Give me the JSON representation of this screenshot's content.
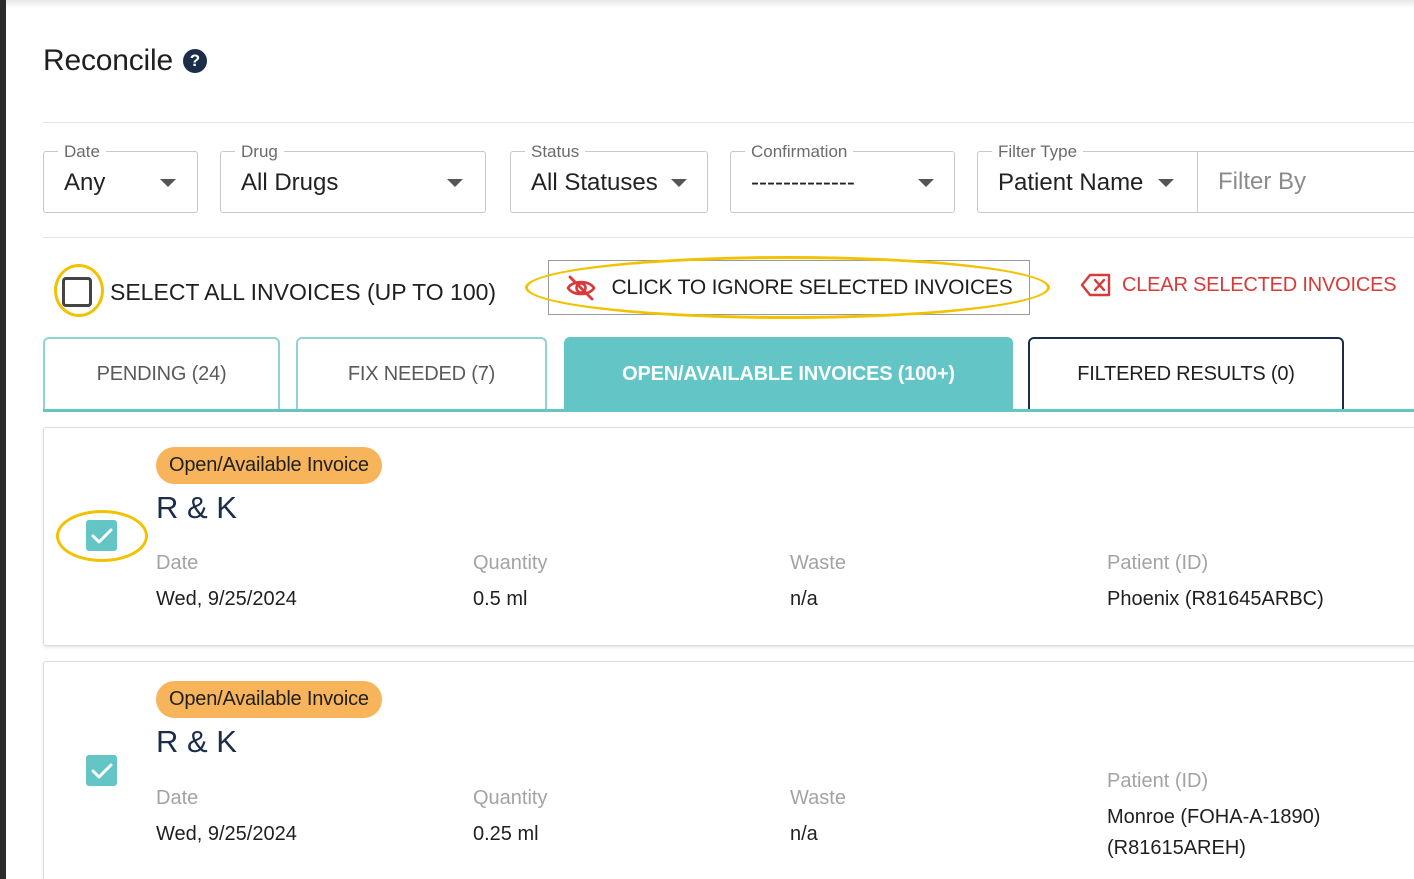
{
  "page": {
    "title": "Reconcile",
    "help_icon_glyph": "?"
  },
  "filters": {
    "date": {
      "label": "Date",
      "value": "Any"
    },
    "drug": {
      "label": "Drug",
      "value": "All Drugs"
    },
    "status": {
      "label": "Status",
      "value": "All Statuses"
    },
    "confirmation": {
      "label": "Confirmation",
      "value": "-------------"
    },
    "filter_type": {
      "label": "Filter Type",
      "value": "Patient Name"
    },
    "filter_by": {
      "placeholder": "Filter By",
      "value": ""
    }
  },
  "actions": {
    "select_all_label": "SELECT ALL INVOICES (UP TO 100)",
    "ignore_label": "CLICK TO IGNORE SELECTED INVOICES",
    "ignore_icon": "eye-slash-icon",
    "clear_label": "CLEAR SELECTED INVOICES",
    "clear_icon": "clear-x-icon"
  },
  "tabs": [
    {
      "label": "PENDING (24)",
      "active": false
    },
    {
      "label": "FIX NEEDED (7)",
      "active": false
    },
    {
      "label": "OPEN/AVAILABLE INVOICES (100+)",
      "active": true
    },
    {
      "label": "FILTERED RESULTS (0)",
      "active": false
    }
  ],
  "invoices": [
    {
      "badge": "Open/Available Invoice",
      "vendor": "R & K",
      "checked": true,
      "date_label": "Date",
      "date": "Wed, 9/25/2024",
      "quantity_label": "Quantity",
      "quantity": "0.5 ml",
      "waste_label": "Waste",
      "waste": "n/a",
      "patient_label": "Patient (ID)",
      "patient": "Phoenix (R81645ARBC)"
    },
    {
      "badge": "Open/Available Invoice",
      "vendor": "R & K",
      "checked": true,
      "date_label": "Date",
      "date": "Wed, 9/25/2024",
      "quantity_label": "Quantity",
      "quantity": "0.25 ml",
      "waste_label": "Waste",
      "waste": "n/a",
      "patient_label": "Patient (ID)",
      "patient_line1": "Monroe (FOHA-A-1890)",
      "patient_line2": "(R81615AREH)"
    }
  ],
  "colors": {
    "accent_teal": "#63c5c6",
    "badge_orange": "#f7b45a",
    "navy": "#1c2d4a",
    "danger_red": "#d83a3a",
    "highlight_yellow": "#f2c200"
  }
}
